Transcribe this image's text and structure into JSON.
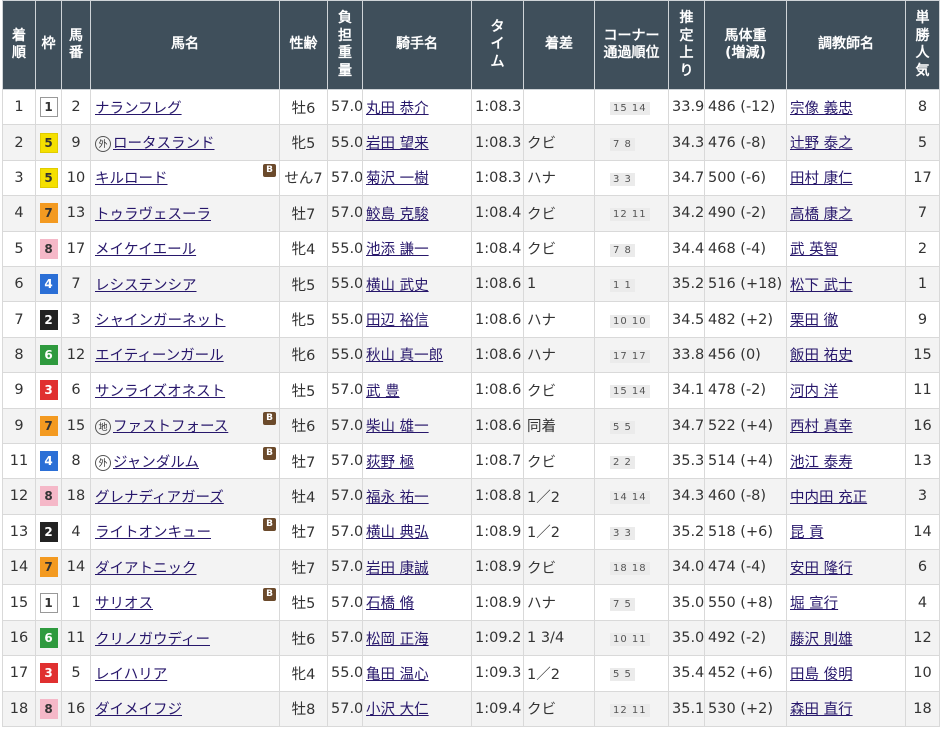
{
  "headers": {
    "rank": "着順",
    "waku": "枠",
    "umaban": "馬番",
    "horse": "馬名",
    "sexage": "性齢",
    "weight": "負担重量",
    "jockey": "騎手名",
    "time": "タイム",
    "margin": "着差",
    "corner": "コーナー通過順位",
    "last3f": "推定上り",
    "bodyweight": "馬体重(増減)",
    "trainer": "調教師名",
    "pop": "単勝人気"
  },
  "waku_colors": {
    "1": {
      "bg": "#ffffff",
      "fg": "#333333",
      "border": "#999999"
    },
    "2": {
      "bg": "#222222",
      "fg": "#ffffff",
      "border": "#222222"
    },
    "3": {
      "bg": "#e03030",
      "fg": "#ffffff",
      "border": "#e03030"
    },
    "4": {
      "bg": "#2b6fd6",
      "fg": "#ffffff",
      "border": "#2b6fd6"
    },
    "5": {
      "bg": "#f5e000",
      "fg": "#333333",
      "border": "#e0cc00"
    },
    "6": {
      "bg": "#2e9a3e",
      "fg": "#ffffff",
      "border": "#2e9a3e"
    },
    "7": {
      "bg": "#f39a21",
      "fg": "#333333",
      "border": "#f39a21"
    },
    "8": {
      "bg": "#f5b8c8",
      "fg": "#333333",
      "border": "#f5b8c8"
    }
  },
  "rows": [
    {
      "rank": "1",
      "waku": "1",
      "umaban": "2",
      "mark": "",
      "horse": "ナランフレグ",
      "blinker": false,
      "sexage": "牡6",
      "weight": "57.0",
      "jockey": "丸田 恭介",
      "time": "1:08.3",
      "margin": "",
      "corner": "15 14",
      "last3f": "33.9",
      "bodyweight": "486 (-12)",
      "trainer": "宗像 義忠",
      "pop": "8"
    },
    {
      "rank": "2",
      "waku": "5",
      "umaban": "9",
      "mark": "外",
      "horse": "ロータスランド",
      "blinker": false,
      "sexage": "牝5",
      "weight": "55.0",
      "jockey": "岩田 望来",
      "time": "1:08.3",
      "margin": "クビ",
      "corner": "7 8",
      "last3f": "34.3",
      "bodyweight": "476 (-8)",
      "trainer": "辻野 泰之",
      "pop": "5"
    },
    {
      "rank": "3",
      "waku": "5",
      "umaban": "10",
      "mark": "",
      "horse": "キルロード",
      "blinker": true,
      "sexage": "せん7",
      "weight": "57.0",
      "jockey": "菊沢 一樹",
      "time": "1:08.3",
      "margin": "ハナ",
      "corner": "3 3",
      "last3f": "34.7",
      "bodyweight": "500 (-6)",
      "trainer": "田村 康仁",
      "pop": "17"
    },
    {
      "rank": "4",
      "waku": "7",
      "umaban": "13",
      "mark": "",
      "horse": "トゥラヴェスーラ",
      "blinker": false,
      "sexage": "牡7",
      "weight": "57.0",
      "jockey": "鮫島 克駿",
      "time": "1:08.4",
      "margin": "クビ",
      "corner": "12 11",
      "last3f": "34.2",
      "bodyweight": "490 (-2)",
      "trainer": "高橋 康之",
      "pop": "7"
    },
    {
      "rank": "5",
      "waku": "8",
      "umaban": "17",
      "mark": "",
      "horse": "メイケイエール",
      "blinker": false,
      "sexage": "牝4",
      "weight": "55.0",
      "jockey": "池添 謙一",
      "time": "1:08.4",
      "margin": "クビ",
      "corner": "7 8",
      "last3f": "34.4",
      "bodyweight": "468 (-4)",
      "trainer": "武 英智",
      "pop": "2"
    },
    {
      "rank": "6",
      "waku": "4",
      "umaban": "7",
      "mark": "",
      "horse": "レシステンシア",
      "blinker": false,
      "sexage": "牝5",
      "weight": "55.0",
      "jockey": "横山 武史",
      "time": "1:08.6",
      "margin": "1",
      "corner": "1 1",
      "last3f": "35.2",
      "bodyweight": "516 (+18)",
      "trainer": "松下 武士",
      "pop": "1"
    },
    {
      "rank": "7",
      "waku": "2",
      "umaban": "3",
      "mark": "",
      "horse": "シャインガーネット",
      "blinker": false,
      "sexage": "牝5",
      "weight": "55.0",
      "jockey": "田辺 裕信",
      "time": "1:08.6",
      "margin": "ハナ",
      "corner": "10 10",
      "last3f": "34.5",
      "bodyweight": "482 (+2)",
      "trainer": "栗田 徹",
      "pop": "9"
    },
    {
      "rank": "8",
      "waku": "6",
      "umaban": "12",
      "mark": "",
      "horse": "エイティーンガール",
      "blinker": false,
      "sexage": "牝6",
      "weight": "55.0",
      "jockey": "秋山 真一郎",
      "time": "1:08.6",
      "margin": "ハナ",
      "corner": "17 17",
      "last3f": "33.8",
      "bodyweight": "456 (0)",
      "trainer": "飯田 祐史",
      "pop": "15"
    },
    {
      "rank": "9",
      "waku": "3",
      "umaban": "6",
      "mark": "",
      "horse": "サンライズオネスト",
      "blinker": false,
      "sexage": "牡5",
      "weight": "57.0",
      "jockey": "武 豊",
      "time": "1:08.6",
      "margin": "クビ",
      "corner": "15 14",
      "last3f": "34.1",
      "bodyweight": "478 (-2)",
      "trainer": "河内 洋",
      "pop": "11"
    },
    {
      "rank": "9",
      "waku": "7",
      "umaban": "15",
      "mark": "地",
      "horse": "ファストフォース",
      "blinker": true,
      "sexage": "牡6",
      "weight": "57.0",
      "jockey": "柴山 雄一",
      "time": "1:08.6",
      "margin": "同着",
      "corner": "5 5",
      "last3f": "34.7",
      "bodyweight": "522 (+4)",
      "trainer": "西村 真幸",
      "pop": "16"
    },
    {
      "rank": "11",
      "waku": "4",
      "umaban": "8",
      "mark": "外",
      "horse": "ジャンダルム",
      "blinker": true,
      "sexage": "牡7",
      "weight": "57.0",
      "jockey": "荻野 極",
      "time": "1:08.7",
      "margin": "クビ",
      "corner": "2 2",
      "last3f": "35.3",
      "bodyweight": "514 (+4)",
      "trainer": "池江 泰寿",
      "pop": "13"
    },
    {
      "rank": "12",
      "waku": "8",
      "umaban": "18",
      "mark": "",
      "horse": "グレナディアガーズ",
      "blinker": false,
      "sexage": "牡4",
      "weight": "57.0",
      "jockey": "福永 祐一",
      "time": "1:08.8",
      "margin": "1／2",
      "corner": "14 14",
      "last3f": "34.3",
      "bodyweight": "460 (-8)",
      "trainer": "中内田 充正",
      "pop": "3"
    },
    {
      "rank": "13",
      "waku": "2",
      "umaban": "4",
      "mark": "",
      "horse": "ライトオンキュー",
      "blinker": true,
      "sexage": "牡7",
      "weight": "57.0",
      "jockey": "横山 典弘",
      "time": "1:08.9",
      "margin": "1／2",
      "corner": "3 3",
      "last3f": "35.2",
      "bodyweight": "518 (+6)",
      "trainer": "昆 貢",
      "pop": "14"
    },
    {
      "rank": "14",
      "waku": "7",
      "umaban": "14",
      "mark": "",
      "horse": "ダイアトニック",
      "blinker": false,
      "sexage": "牡7",
      "weight": "57.0",
      "jockey": "岩田 康誠",
      "time": "1:08.9",
      "margin": "クビ",
      "corner": "18 18",
      "last3f": "34.0",
      "bodyweight": "474 (-4)",
      "trainer": "安田 隆行",
      "pop": "6"
    },
    {
      "rank": "15",
      "waku": "1",
      "umaban": "1",
      "mark": "",
      "horse": "サリオス",
      "blinker": true,
      "sexage": "牡5",
      "weight": "57.0",
      "jockey": "石橋 脩",
      "time": "1:08.9",
      "margin": "ハナ",
      "corner": "7 5",
      "last3f": "35.0",
      "bodyweight": "550 (+8)",
      "trainer": "堀 宣行",
      "pop": "4"
    },
    {
      "rank": "16",
      "waku": "6",
      "umaban": "11",
      "mark": "",
      "horse": "クリノガウディー",
      "blinker": false,
      "sexage": "牡6",
      "weight": "57.0",
      "jockey": "松岡 正海",
      "time": "1:09.2",
      "margin": "1 3/4",
      "corner": "10 11",
      "last3f": "35.0",
      "bodyweight": "492 (-2)",
      "trainer": "藤沢 則雄",
      "pop": "12"
    },
    {
      "rank": "17",
      "waku": "3",
      "umaban": "5",
      "mark": "",
      "horse": "レイハリア",
      "blinker": false,
      "sexage": "牝4",
      "weight": "55.0",
      "jockey": "亀田 温心",
      "time": "1:09.3",
      "margin": "1／2",
      "corner": "5 5",
      "last3f": "35.4",
      "bodyweight": "452 (+6)",
      "trainer": "田島 俊明",
      "pop": "10"
    },
    {
      "rank": "18",
      "waku": "8",
      "umaban": "16",
      "mark": "",
      "horse": "ダイメイフジ",
      "blinker": false,
      "sexage": "牡8",
      "weight": "57.0",
      "jockey": "小沢 大仁",
      "time": "1:09.4",
      "margin": "クビ",
      "corner": "12 11",
      "last3f": "35.1",
      "bodyweight": "530 (+2)",
      "trainer": "森田 直行",
      "pop": "18"
    }
  ]
}
